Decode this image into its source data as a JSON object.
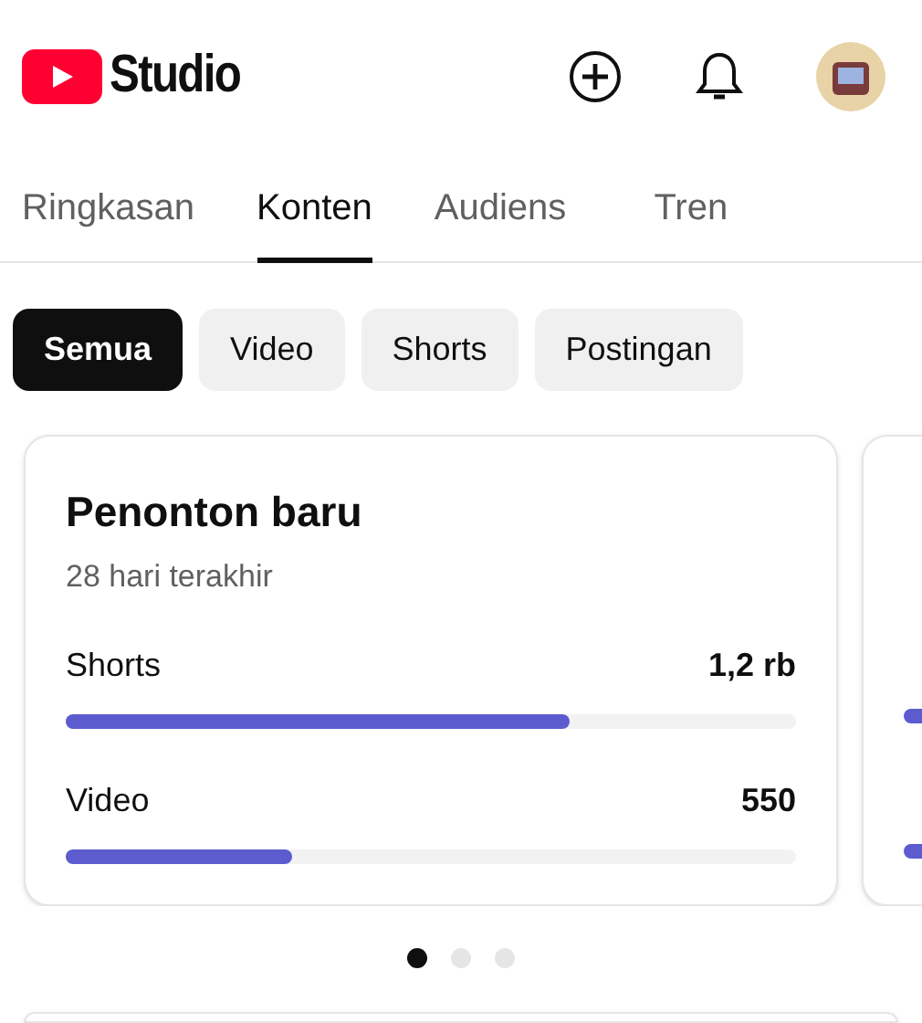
{
  "app_bar": {
    "brand": "Studio"
  },
  "tabs": [
    {
      "label": "Ringkasan",
      "selected": false
    },
    {
      "label": "Konten",
      "selected": true
    },
    {
      "label": "Audiens",
      "selected": false
    },
    {
      "label": "Tren",
      "selected": false
    }
  ],
  "filters": [
    {
      "label": "Semua",
      "selected": true
    },
    {
      "label": "Video",
      "selected": false
    },
    {
      "label": "Shorts",
      "selected": false
    },
    {
      "label": "Postingan",
      "selected": false
    }
  ],
  "cards": [
    {
      "title": "Penonton baru",
      "subtitle": "28 hari terakhir",
      "rows": [
        {
          "label": "Shorts",
          "value": "1,2 rb",
          "level": 0.69
        },
        {
          "label": "Video",
          "value": "550",
          "level": 0.31
        }
      ]
    }
  ],
  "pager": [
    {
      "selected": true
    },
    {
      "selected": false
    },
    {
      "selected": false
    }
  ]
}
